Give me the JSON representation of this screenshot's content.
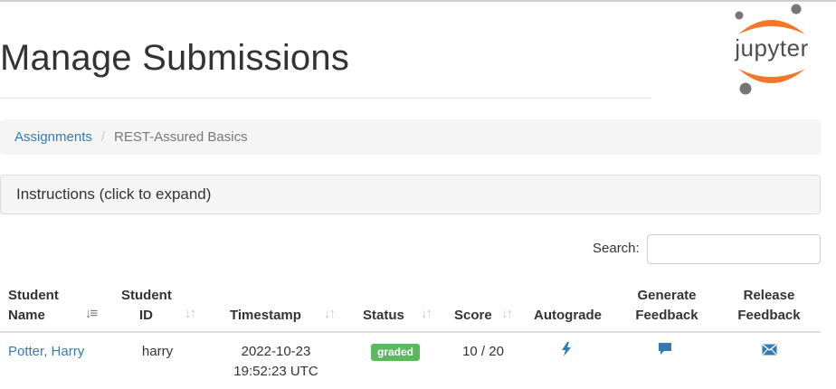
{
  "header": {
    "title": "Manage Submissions",
    "logo_text": "jupyter"
  },
  "breadcrumb": {
    "items": [
      {
        "label": "Assignments"
      },
      {
        "label": "REST-Assured Basics"
      }
    ],
    "separator": "/"
  },
  "instructions": {
    "label": "Instructions (click to expand)"
  },
  "search": {
    "label": "Search:",
    "value": "",
    "placeholder": ""
  },
  "table": {
    "columns": [
      {
        "line1": "Student",
        "line2": "Name",
        "sort": "sort-desc-active-icon"
      },
      {
        "line1": "Student",
        "line2": "ID",
        "sort": "sort-icon"
      },
      {
        "line1": "",
        "line2": "Timestamp",
        "sort": "sort-icon"
      },
      {
        "line1": "",
        "line2": "Status",
        "sort": "sort-icon"
      },
      {
        "line1": "",
        "line2": "Score",
        "sort": "sort-icon"
      },
      {
        "line1": "",
        "line2": "Autograde",
        "sort": ""
      },
      {
        "line1": "Generate",
        "line2": "Feedback",
        "sort": ""
      },
      {
        "line1": "Release",
        "line2": "Feedback",
        "sort": ""
      }
    ],
    "rows": [
      {
        "student_name": "Potter, Harry",
        "student_id": "harry",
        "timestamp_date": "2022-10-23",
        "timestamp_time": "19:52:23 UTC",
        "status": "graded",
        "score": "10 / 20",
        "autograde_icon": "lightning-bolt-icon",
        "generate_icon": "comment-icon",
        "release_icon": "envelope-icon"
      }
    ]
  },
  "colors": {
    "link": "#337ab7",
    "badge_success": "#5cb85c",
    "jupyter_orange": "#f37726",
    "jupyter_gray": "#767677"
  }
}
